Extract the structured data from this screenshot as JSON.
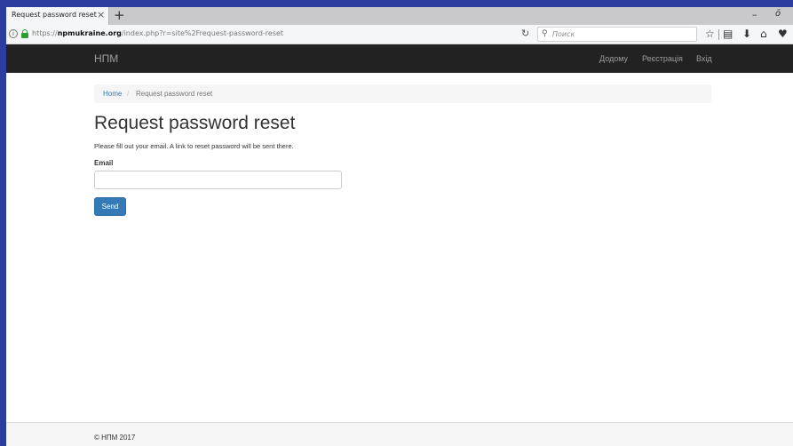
{
  "browser": {
    "tab": {
      "title": "Request password reset",
      "close_glyph": "×"
    },
    "new_tab_glyph": "+",
    "window_controls": {
      "minimize": "–",
      "restore": "ō"
    },
    "url": {
      "prefix": "https://",
      "host": "npmukraine.org",
      "path": "/index.php?r=site%2Frequest-password-reset"
    },
    "search": {
      "placeholder": "Поиск"
    },
    "icons": {
      "info": "info-icon",
      "lock": "lock-icon",
      "reload": "reload-icon",
      "search": "search-icon",
      "bookmark": "star-icon",
      "library": "bookmarks-list-icon",
      "download": "download-icon",
      "home": "home-icon",
      "pocket": "pocket-icon"
    }
  },
  "navbar": {
    "brand": "НПМ",
    "links": [
      "Додому",
      "Реєстрація",
      "Вхід"
    ]
  },
  "breadcrumb": {
    "home": "Home",
    "separator": "/",
    "current": "Request password reset"
  },
  "page": {
    "title": "Request password reset",
    "description": "Please fill out your email. A link to reset password will be sent there."
  },
  "form": {
    "email_label": "Email",
    "email_value": "",
    "submit_label": "Send"
  },
  "footer": {
    "text": "© НПМ 2017"
  },
  "colors": {
    "navbar_bg": "#222222",
    "link": "#337ab7",
    "primary_button": "#337ab7",
    "secure_lock": "#2e9c2e"
  }
}
